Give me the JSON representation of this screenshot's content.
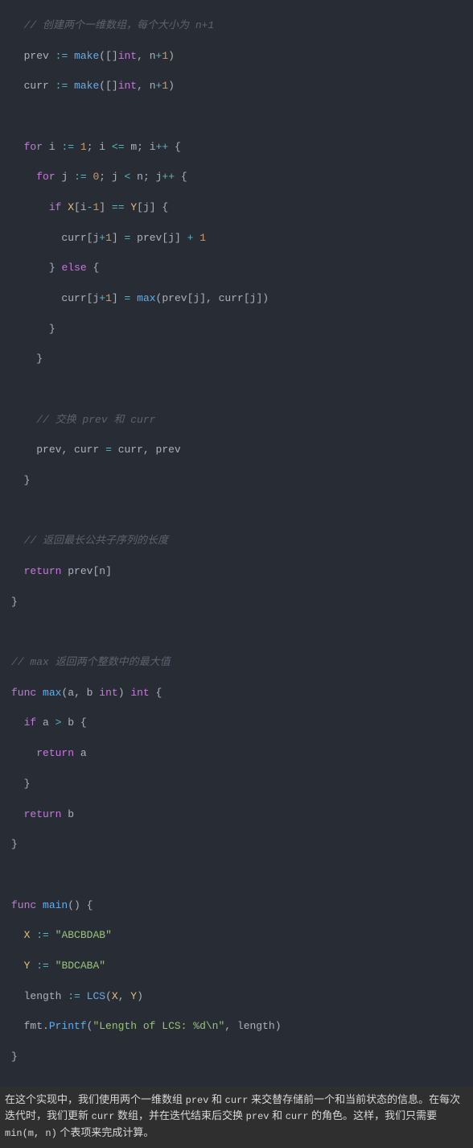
{
  "code": {
    "c1": "// 创建两个一维数组，每个大小为 n+1",
    "v_prev": "prev",
    "op_decl": ":=",
    "fn_make": "make",
    "paren_open": "(",
    "br2_open": "[]",
    "t_int": "int",
    "comma_sp": ", ",
    "v_n": "n",
    "op_plus": "+",
    "n1": "1",
    "paren_close": ")",
    "v_curr": "curr",
    "kw_for": "for",
    "v_i": "i",
    "op_le": "<=",
    "v_m": "m",
    "semi_sp": "; ",
    "op_pp": "++",
    "brace_o": "{",
    "brace_c": "}",
    "v_j": "j",
    "n0": "0",
    "op_lt": "<",
    "kw_if": "if",
    "v_X": "X",
    "br_o": "[",
    "br_c": "]",
    "op_minus": "-",
    "op_eq": "==",
    "v_Y": "Y",
    "op_assign": "=",
    "kw_else": "else",
    "fn_max": "max",
    "c2": "// 交换 prev 和 curr",
    "c3": "// 返回最长公共子序列的长度",
    "kw_return": "return",
    "c4": "// max 返回两个整数中的最大值",
    "kw_func": "func",
    "v_a": "a",
    "v_b": "b",
    "op_gt": ">",
    "fn_main": "main",
    "empty_parens": "()",
    "s_ABCBDAB": "\"ABCBDAB\"",
    "s_BDCABA": "\"BDCABA\"",
    "v_length": "length",
    "fn_LCS": "LCS",
    "v_fmt": "fmt",
    "dot": ".",
    "fn_Printf": "Printf",
    "s_fmt": "\"Length of LCS: %d\\n\""
  },
  "explain": {
    "p1a": "在这个实现中，我们使用两个一维数组 ",
    "p1b": "prev",
    "p1c": " 和 ",
    "p1d": "curr",
    "p1e": " 来交替存储前一个和当前状态的信息。在每次迭代时，我们更新 ",
    "p1f": "curr",
    "p1g": " 数组，并在迭代结束后交换 ",
    "p1h": "prev",
    "p1i": " 和 ",
    "p1j": "curr",
    "p1k": " 的角色。这样，我们只需要 ",
    "p1l": "min(m, n)",
    "p1m": " 个表项来完成计算。"
  }
}
